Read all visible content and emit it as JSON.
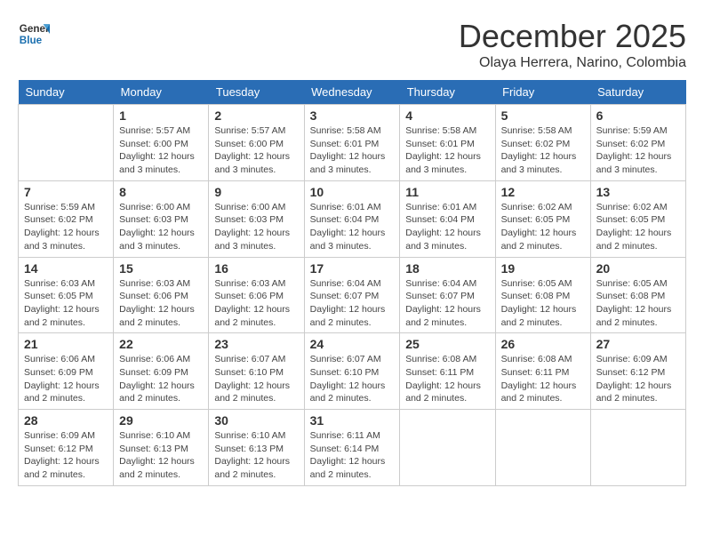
{
  "header": {
    "logo_line1": "General",
    "logo_line2": "Blue",
    "month": "December 2025",
    "location": "Olaya Herrera, Narino, Colombia"
  },
  "weekdays": [
    "Sunday",
    "Monday",
    "Tuesday",
    "Wednesday",
    "Thursday",
    "Friday",
    "Saturday"
  ],
  "weeks": [
    [
      {
        "num": "",
        "detail": ""
      },
      {
        "num": "1",
        "detail": "Sunrise: 5:57 AM\nSunset: 6:00 PM\nDaylight: 12 hours\nand 3 minutes."
      },
      {
        "num": "2",
        "detail": "Sunrise: 5:57 AM\nSunset: 6:00 PM\nDaylight: 12 hours\nand 3 minutes."
      },
      {
        "num": "3",
        "detail": "Sunrise: 5:58 AM\nSunset: 6:01 PM\nDaylight: 12 hours\nand 3 minutes."
      },
      {
        "num": "4",
        "detail": "Sunrise: 5:58 AM\nSunset: 6:01 PM\nDaylight: 12 hours\nand 3 minutes."
      },
      {
        "num": "5",
        "detail": "Sunrise: 5:58 AM\nSunset: 6:02 PM\nDaylight: 12 hours\nand 3 minutes."
      },
      {
        "num": "6",
        "detail": "Sunrise: 5:59 AM\nSunset: 6:02 PM\nDaylight: 12 hours\nand 3 minutes."
      }
    ],
    [
      {
        "num": "7",
        "detail": "Sunrise: 5:59 AM\nSunset: 6:02 PM\nDaylight: 12 hours\nand 3 minutes."
      },
      {
        "num": "8",
        "detail": "Sunrise: 6:00 AM\nSunset: 6:03 PM\nDaylight: 12 hours\nand 3 minutes."
      },
      {
        "num": "9",
        "detail": "Sunrise: 6:00 AM\nSunset: 6:03 PM\nDaylight: 12 hours\nand 3 minutes."
      },
      {
        "num": "10",
        "detail": "Sunrise: 6:01 AM\nSunset: 6:04 PM\nDaylight: 12 hours\nand 3 minutes."
      },
      {
        "num": "11",
        "detail": "Sunrise: 6:01 AM\nSunset: 6:04 PM\nDaylight: 12 hours\nand 3 minutes."
      },
      {
        "num": "12",
        "detail": "Sunrise: 6:02 AM\nSunset: 6:05 PM\nDaylight: 12 hours\nand 2 minutes."
      },
      {
        "num": "13",
        "detail": "Sunrise: 6:02 AM\nSunset: 6:05 PM\nDaylight: 12 hours\nand 2 minutes."
      }
    ],
    [
      {
        "num": "14",
        "detail": "Sunrise: 6:03 AM\nSunset: 6:05 PM\nDaylight: 12 hours\nand 2 minutes."
      },
      {
        "num": "15",
        "detail": "Sunrise: 6:03 AM\nSunset: 6:06 PM\nDaylight: 12 hours\nand 2 minutes."
      },
      {
        "num": "16",
        "detail": "Sunrise: 6:03 AM\nSunset: 6:06 PM\nDaylight: 12 hours\nand 2 minutes."
      },
      {
        "num": "17",
        "detail": "Sunrise: 6:04 AM\nSunset: 6:07 PM\nDaylight: 12 hours\nand 2 minutes."
      },
      {
        "num": "18",
        "detail": "Sunrise: 6:04 AM\nSunset: 6:07 PM\nDaylight: 12 hours\nand 2 minutes."
      },
      {
        "num": "19",
        "detail": "Sunrise: 6:05 AM\nSunset: 6:08 PM\nDaylight: 12 hours\nand 2 minutes."
      },
      {
        "num": "20",
        "detail": "Sunrise: 6:05 AM\nSunset: 6:08 PM\nDaylight: 12 hours\nand 2 minutes."
      }
    ],
    [
      {
        "num": "21",
        "detail": "Sunrise: 6:06 AM\nSunset: 6:09 PM\nDaylight: 12 hours\nand 2 minutes."
      },
      {
        "num": "22",
        "detail": "Sunrise: 6:06 AM\nSunset: 6:09 PM\nDaylight: 12 hours\nand 2 minutes."
      },
      {
        "num": "23",
        "detail": "Sunrise: 6:07 AM\nSunset: 6:10 PM\nDaylight: 12 hours\nand 2 minutes."
      },
      {
        "num": "24",
        "detail": "Sunrise: 6:07 AM\nSunset: 6:10 PM\nDaylight: 12 hours\nand 2 minutes."
      },
      {
        "num": "25",
        "detail": "Sunrise: 6:08 AM\nSunset: 6:11 PM\nDaylight: 12 hours\nand 2 minutes."
      },
      {
        "num": "26",
        "detail": "Sunrise: 6:08 AM\nSunset: 6:11 PM\nDaylight: 12 hours\nand 2 minutes."
      },
      {
        "num": "27",
        "detail": "Sunrise: 6:09 AM\nSunset: 6:12 PM\nDaylight: 12 hours\nand 2 minutes."
      }
    ],
    [
      {
        "num": "28",
        "detail": "Sunrise: 6:09 AM\nSunset: 6:12 PM\nDaylight: 12 hours\nand 2 minutes."
      },
      {
        "num": "29",
        "detail": "Sunrise: 6:10 AM\nSunset: 6:13 PM\nDaylight: 12 hours\nand 2 minutes."
      },
      {
        "num": "30",
        "detail": "Sunrise: 6:10 AM\nSunset: 6:13 PM\nDaylight: 12 hours\nand 2 minutes."
      },
      {
        "num": "31",
        "detail": "Sunrise: 6:11 AM\nSunset: 6:14 PM\nDaylight: 12 hours\nand 2 minutes."
      },
      {
        "num": "",
        "detail": ""
      },
      {
        "num": "",
        "detail": ""
      },
      {
        "num": "",
        "detail": ""
      }
    ]
  ]
}
